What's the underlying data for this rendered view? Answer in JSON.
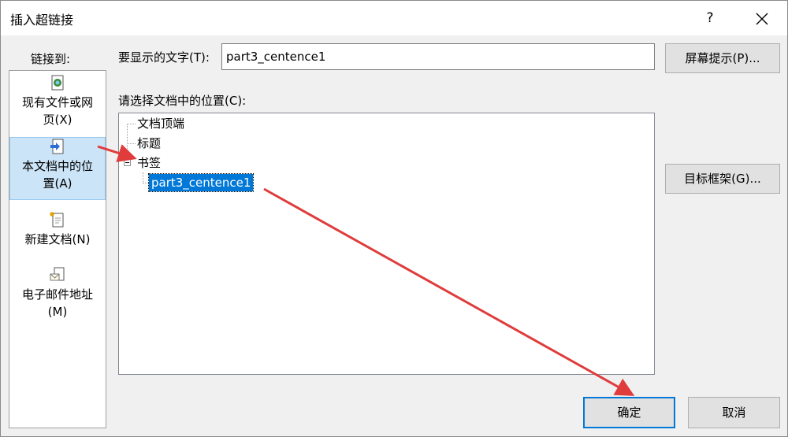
{
  "dialog": {
    "title": "插入超链接",
    "help_label": "?"
  },
  "nav": {
    "header": "链接到:",
    "items": [
      {
        "label": "现有文件或网页(X)",
        "line1": "现有文件或网",
        "line2": "页(X)",
        "icon": "existing-file-icon",
        "selected": false
      },
      {
        "label": "本文档中的位置(A)",
        "line1": "本文档中的位",
        "line2": "置(A)",
        "icon": "place-in-document-icon",
        "selected": true
      },
      {
        "label": "新建文档(N)",
        "line1": "新建文档(N)",
        "line2": "",
        "icon": "new-document-icon",
        "selected": false
      },
      {
        "label": "电子邮件地址(M)",
        "line1": "电子邮件地址",
        "line2": "(M)",
        "icon": "email-address-icon",
        "selected": false
      }
    ]
  },
  "text_to_display": {
    "label": "要显示的文字(T):",
    "value": "part3_centence1"
  },
  "screentip_button": "屏幕提示(P)...",
  "place_label": "请选择文档中的位置(C):",
  "tree": {
    "top_of_document": "文档顶端",
    "headings": "标题",
    "bookmarks": "书签",
    "bookmark_items": [
      "part3_centence1"
    ]
  },
  "target_frame_button": "目标框架(G)...",
  "ok_button": "确定",
  "cancel_button": "取消",
  "annotation_color": "#e03c3c"
}
